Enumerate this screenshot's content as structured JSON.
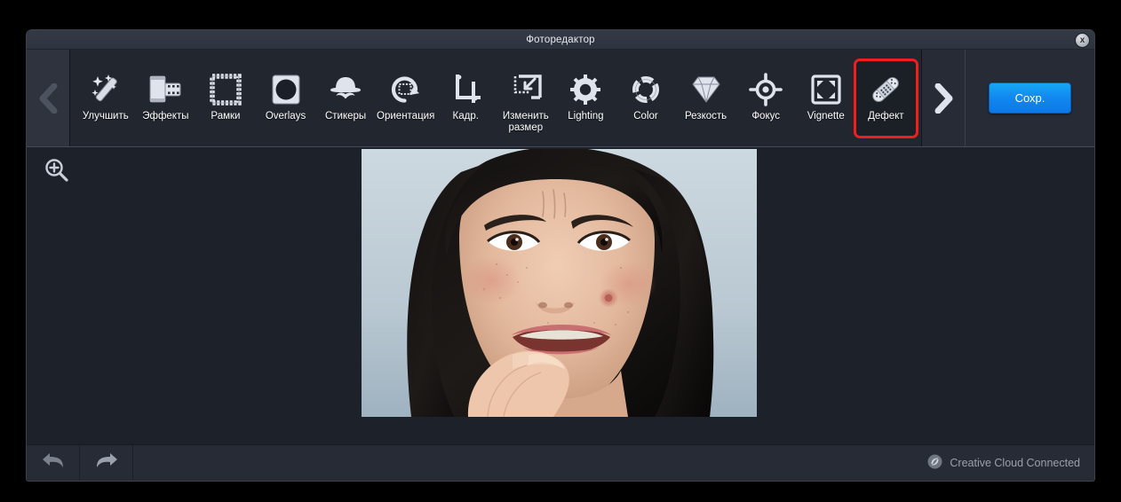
{
  "window": {
    "title": "Фоторедактор",
    "close_label": "x"
  },
  "toolbar": {
    "prev_arrow": "chevron-left-icon",
    "next_arrow": "chevron-right-icon",
    "save_label": "Сохр.",
    "selected_tool": "Дефект",
    "highlight_color": "#f01f1f",
    "accent_color": "#1187ef",
    "tools": [
      {
        "id": "enhance",
        "label": "Улучшить",
        "icon": "magic-wand-icon"
      },
      {
        "id": "effects",
        "label": "Эффекты",
        "icon": "film-roll-icon"
      },
      {
        "id": "frames",
        "label": "Рамки",
        "icon": "frame-icon"
      },
      {
        "id": "overlays",
        "label": "Overlays",
        "icon": "overlay-circle-icon"
      },
      {
        "id": "stickers",
        "label": "Стикеры",
        "icon": "hat-mustache-icon"
      },
      {
        "id": "orient",
        "label": "Ориентация",
        "icon": "rotate-icon"
      },
      {
        "id": "crop",
        "label": "Кадр.",
        "icon": "crop-icon"
      },
      {
        "id": "resize",
        "label": "Изменить\nразмер",
        "icon": "resize-icon"
      },
      {
        "id": "lighting",
        "label": "Lighting",
        "icon": "sun-icon"
      },
      {
        "id": "color",
        "label": "Color",
        "icon": "color-wheel-icon"
      },
      {
        "id": "sharpness",
        "label": "Резкость",
        "icon": "diamond-icon"
      },
      {
        "id": "focus",
        "label": "Фокус",
        "icon": "target-icon"
      },
      {
        "id": "vignette",
        "label": "Vignette",
        "icon": "vignette-icon"
      },
      {
        "id": "blemish",
        "label": "Дефект",
        "icon": "bandage-icon"
      }
    ]
  },
  "canvas": {
    "zoom_icon": "zoom-in-icon",
    "image_alt": "Портрет женщины с тёмными волосами"
  },
  "statusbar": {
    "undo_icon": "undo-arrow-icon",
    "redo_icon": "redo-arrow-icon",
    "cloud_icon": "creative-cloud-icon",
    "cloud_label": "Creative Cloud Connected"
  }
}
